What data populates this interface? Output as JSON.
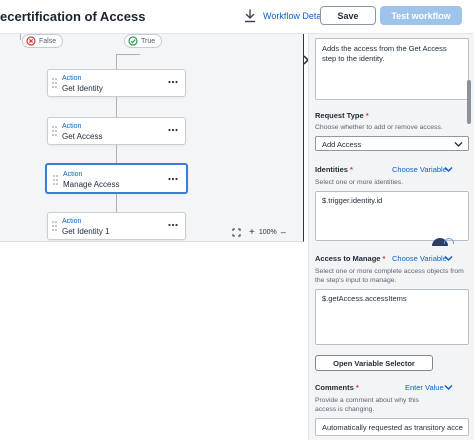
{
  "header": {
    "title": "ecertification of Access",
    "download_icon": "download-icon",
    "workflow_details": "Workflow Details",
    "save_label": "Save",
    "test_label": "Test workflow"
  },
  "canvas": {
    "branches": [
      {
        "label": "False",
        "icon": "x-circle-icon",
        "color": "#d33a3a"
      },
      {
        "label": "True",
        "icon": "check-circle-icon",
        "color": "#2f9a52"
      }
    ],
    "nodes": [
      {
        "type": "Action",
        "name": "Get Identity"
      },
      {
        "type": "Action",
        "name": "Get Access"
      },
      {
        "type": "Action",
        "name": "Manage Access",
        "selected": true
      },
      {
        "type": "Action",
        "name": "Get Identity 1"
      }
    ],
    "zoom": {
      "level": "100%",
      "plus": "+",
      "minus": "–"
    }
  },
  "panel": {
    "description": "Adds the access from the Get Access step to the identity.",
    "request_type": {
      "label": "Request Type",
      "required": "*",
      "help": "Choose whether to add or remove access.",
      "value": "Add Access"
    },
    "identities": {
      "label": "Identities",
      "required": "*",
      "choose": "Choose Variable",
      "help": "Select one or more identities.",
      "value": "$.trigger.identity.id"
    },
    "access_to_manage": {
      "label": "Access to Manage",
      "required": "*",
      "choose": "Choose Variable",
      "help": "Select one or more complete access objects from the step's input to manage.",
      "value": "$.getAccess.accessItems"
    },
    "open_variable_selector": "Open Variable Selector",
    "comments": {
      "label": "Comments",
      "required": "*",
      "choose": "Enter Value",
      "help": "Provide a comment about why this access is changing.",
      "value": "Automatically requested as transitory acce"
    }
  },
  "colors": {
    "accent": "#0b63c4",
    "selected_border": "#3b7fd1",
    "test_button": "#9ec4ec",
    "required": "#d33a3a"
  }
}
